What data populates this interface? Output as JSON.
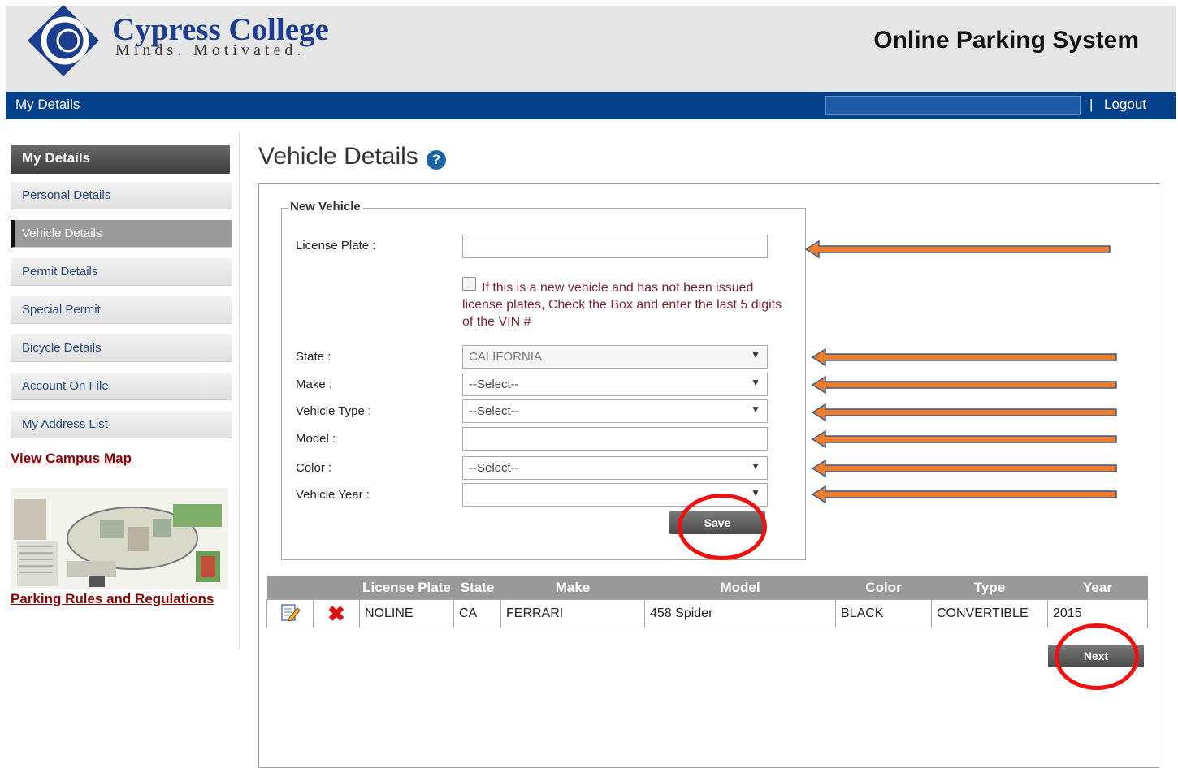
{
  "header": {
    "logo_name": "Cypress College",
    "logo_tagline": "Minds. Motivated.",
    "system_title": "Online Parking System"
  },
  "navbar": {
    "title": "My Details",
    "separator": "|",
    "logout": "Logout"
  },
  "sidebar": {
    "heading": "My Details",
    "items": [
      {
        "label": "Personal Details"
      },
      {
        "label": "Vehicle Details"
      },
      {
        "label": "Permit Details"
      },
      {
        "label": "Special Permit"
      },
      {
        "label": "Bicycle Details"
      },
      {
        "label": "Account On File"
      },
      {
        "label": "My Address List"
      }
    ],
    "active_item": "Vehicle Details",
    "campus_map_link": "View Campus Map",
    "rules_link": "Parking Rules and Regulations"
  },
  "main": {
    "title": "Vehicle Details",
    "help_icon": "?",
    "form": {
      "legend": "New Vehicle",
      "license_plate_label": "License Plate :",
      "license_plate_value": "",
      "vin_note": "If this is a new vehicle and has not been issued license plates, Check the Box and enter the last 5 digits of the VIN #",
      "state_label": "State :",
      "state_value": "CALIFORNIA",
      "make_label": "Make :",
      "make_value": "--Select--",
      "vehicle_type_label": "Vehicle Type :",
      "vehicle_type_value": "--Select--",
      "model_label": "Model :",
      "model_value": "",
      "color_label": "Color :",
      "color_value": "--Select--",
      "year_label": "Vehicle Year :",
      "year_value": "",
      "save_label": "Save"
    },
    "table": {
      "headers": [
        "",
        "",
        "License Plate",
        "State",
        "Make",
        "Model",
        "Color",
        "Type",
        "Year"
      ],
      "rows": [
        {
          "plate": "NOLINE",
          "state": "CA",
          "make": "FERRARI",
          "model": "458 Spider",
          "color": "BLACK",
          "type": "CONVERTIBLE",
          "year": "2015"
        }
      ]
    },
    "next_label": "Next"
  },
  "colors": {
    "navbar": "#05408a",
    "brand_blue": "#1d3e8e",
    "annotation_arrow": "#ee7d2b",
    "annotation_circle": "#e11111"
  }
}
